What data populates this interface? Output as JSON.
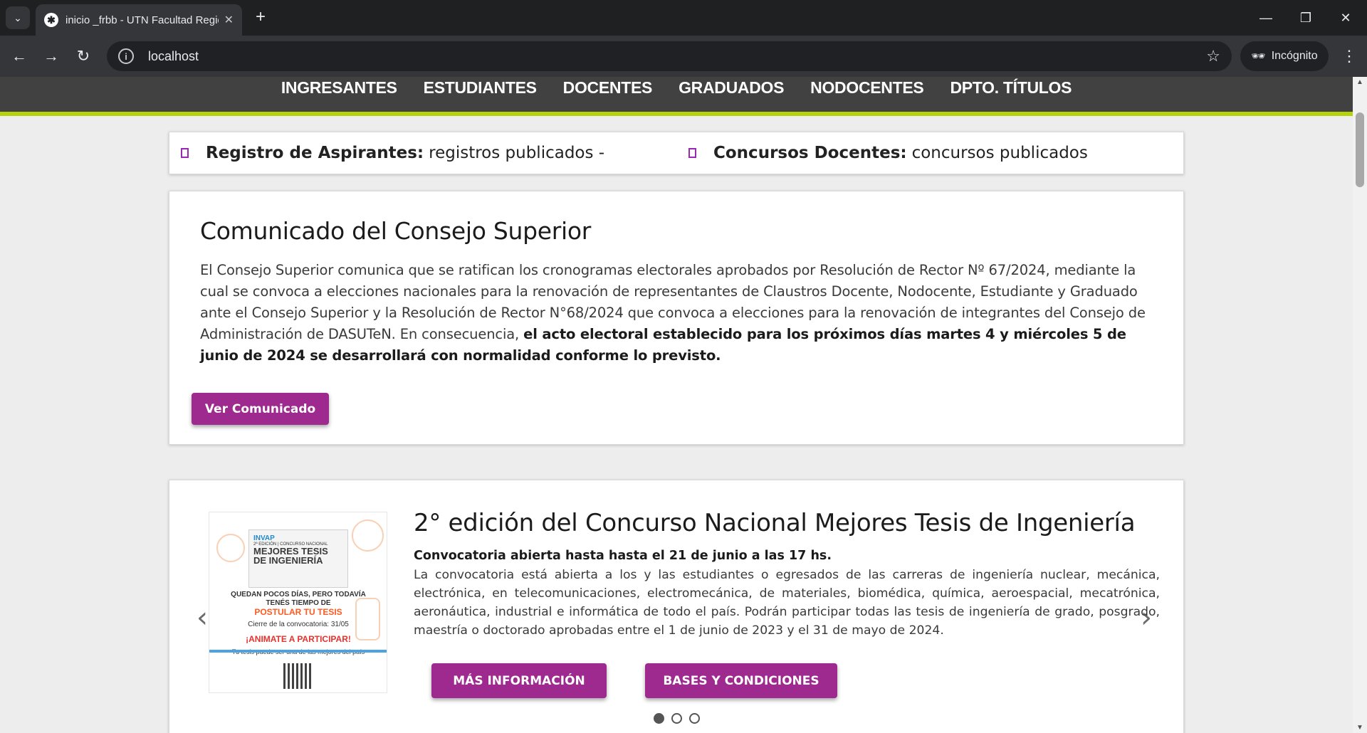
{
  "browser": {
    "tab_title": "inicio _frbb - UTN Facultad Regional Bahía Blanca",
    "url": "localhost",
    "incognito_label": "Incógnito"
  },
  "site_nav": {
    "items": [
      "INGRESANTES",
      "ESTUDIANTES",
      "DOCENTES",
      "GRADUADOS",
      "NODOCENTES",
      "DPTO. TÍTULOS"
    ]
  },
  "ticker": {
    "items": [
      {
        "bold": "Registro de Aspirantes:",
        "text": "registros publicados -"
      },
      {
        "bold": "Concursos Docentes:",
        "text": "concursos publicados"
      }
    ]
  },
  "comunicado": {
    "title": "Comunicado del Consejo Superior",
    "body": "El Consejo Superior comunica que se ratifican los cronogramas electorales aprobados por Resolución de Rector Nº 67/2024, mediante la cual se convoca a elecciones nacionales para la renovación de representantes de Claustros Docente, Nodocente, Estudiante y Graduado ante el Consejo Superior y la Resolución de Rector N°68/2024 que convoca a elecciones para la renovación de integrantes del Consejo de Administración de DASUTeN. En consecuencia,",
    "body_bold": "el acto electoral establecido para los próximos días martes 4 y miércoles 5 de junio de 2024 se desarrollará con normalidad conforme lo previsto.",
    "button": "Ver Comunicado"
  },
  "slider": {
    "title": "2° edición del Concurso Nacional Mejores Tesis de Ingeniería",
    "subtitle": "Convocatoria abierta hasta hasta el 21 de junio a las 17 hs.",
    "body": "La convocatoria está abierta a los y las estudiantes o egresados de las carreras de ingeniería nuclear, mecánica, electrónica, en telecomunicaciones, electromecánica, de materiales, biomédica, química, aeroespacial, mecatrónica, aeronáutica, industrial e informática de todo el país. Podrán participar todas las tesis de ingeniería de grado, posgrado, maestría o doctorado aprobadas entre el 1 de junio de 2023 y el 31 de mayo de 2024.",
    "button_more": "Más información",
    "button_bases": "Bases y condiciones",
    "slide_count": 3,
    "active_slide": 1,
    "image": {
      "brand": "INVAP",
      "edition": "2ª EDICIÓN | CONCURSO NACIONAL",
      "heading": "MEJORES TESIS DE INGENIERÍA",
      "line1": "QUEDAN POCOS DÍAS, PERO TODAVÍA TENÉS TIEMPO DE",
      "line2": "POSTULAR TU TESIS",
      "line3": "Cierre de la convocatoria: 31/05",
      "line4": "¡ANIMATE A PARTICIPAR!",
      "line5": "Tu tesis puede ser una de las mejores del país"
    }
  }
}
